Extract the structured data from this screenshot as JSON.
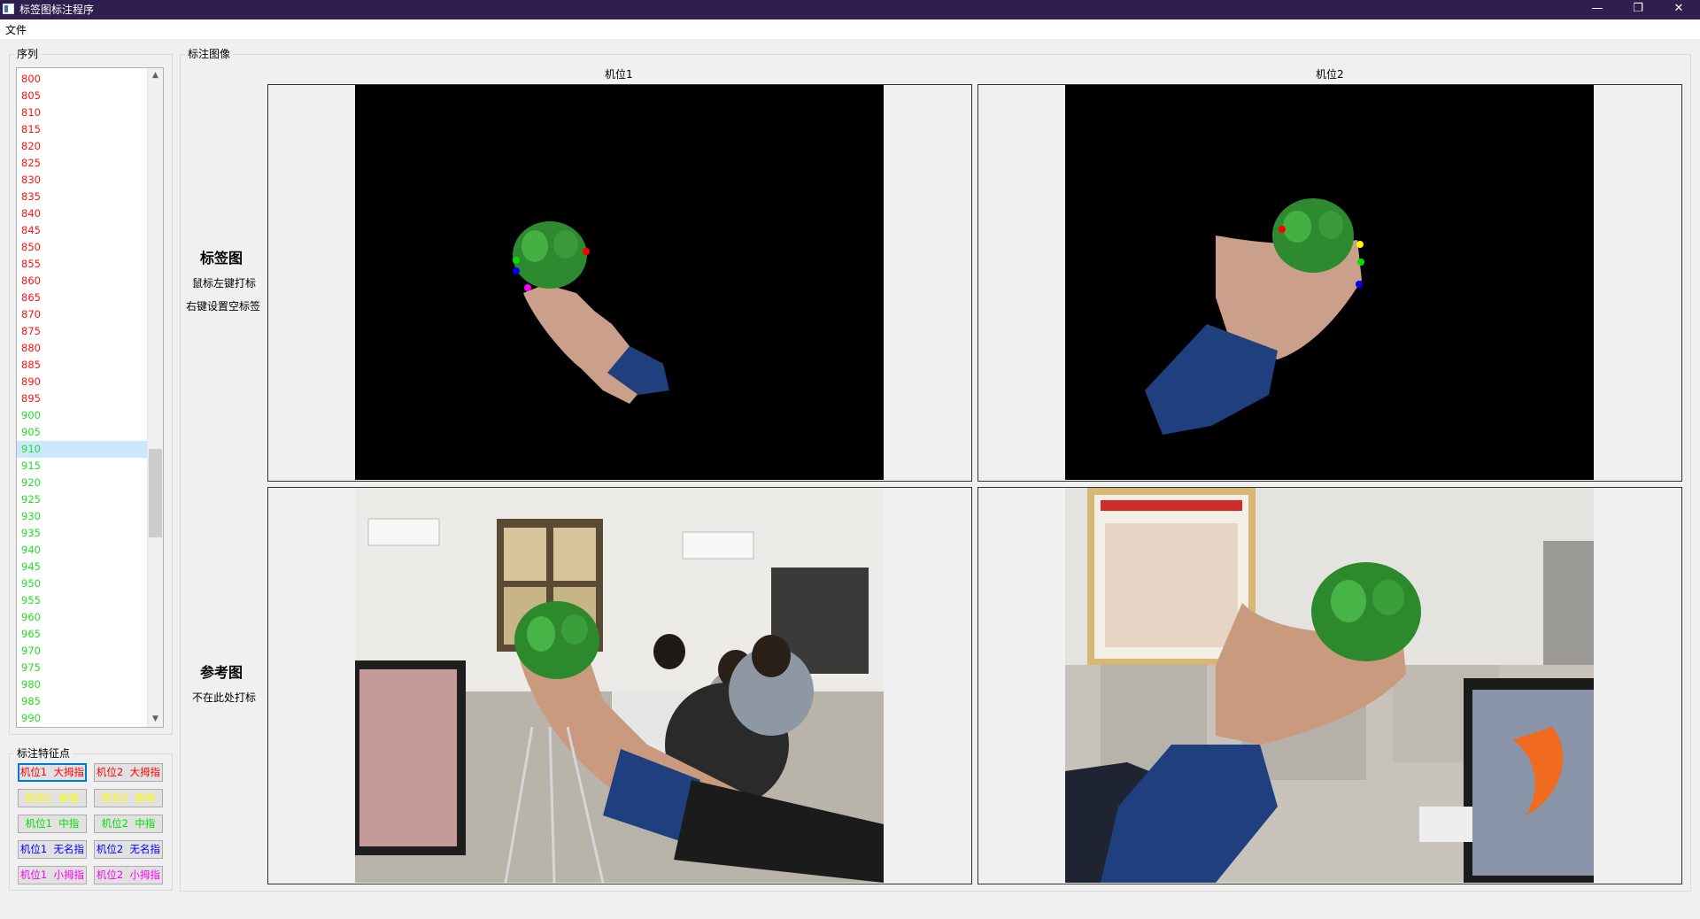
{
  "window": {
    "title": "标签图标注程序",
    "controls": [
      "—",
      "❐",
      "✕"
    ]
  },
  "menu": {
    "file": "文件"
  },
  "sequence": {
    "group_title": "序列",
    "items": [
      {
        "label": "800",
        "state": "labeled"
      },
      {
        "label": "805",
        "state": "labeled"
      },
      {
        "label": "810",
        "state": "labeled"
      },
      {
        "label": "815",
        "state": "labeled"
      },
      {
        "label": "820",
        "state": "labeled"
      },
      {
        "label": "825",
        "state": "labeled"
      },
      {
        "label": "830",
        "state": "labeled"
      },
      {
        "label": "835",
        "state": "labeled"
      },
      {
        "label": "840",
        "state": "labeled"
      },
      {
        "label": "845",
        "state": "labeled"
      },
      {
        "label": "850",
        "state": "labeled"
      },
      {
        "label": "855",
        "state": "labeled"
      },
      {
        "label": "860",
        "state": "labeled"
      },
      {
        "label": "865",
        "state": "labeled"
      },
      {
        "label": "870",
        "state": "labeled"
      },
      {
        "label": "875",
        "state": "labeled"
      },
      {
        "label": "880",
        "state": "labeled"
      },
      {
        "label": "885",
        "state": "labeled"
      },
      {
        "label": "890",
        "state": "labeled"
      },
      {
        "label": "895",
        "state": "labeled"
      },
      {
        "label": "900",
        "state": "pending"
      },
      {
        "label": "905",
        "state": "pending"
      },
      {
        "label": "910",
        "state": "pending",
        "selected": true
      },
      {
        "label": "915",
        "state": "pending"
      },
      {
        "label": "920",
        "state": "pending"
      },
      {
        "label": "925",
        "state": "pending"
      },
      {
        "label": "930",
        "state": "pending"
      },
      {
        "label": "935",
        "state": "pending"
      },
      {
        "label": "940",
        "state": "pending"
      },
      {
        "label": "945",
        "state": "pending"
      },
      {
        "label": "950",
        "state": "pending"
      },
      {
        "label": "955",
        "state": "pending"
      },
      {
        "label": "960",
        "state": "pending"
      },
      {
        "label": "965",
        "state": "pending"
      },
      {
        "label": "970",
        "state": "pending"
      },
      {
        "label": "975",
        "state": "pending"
      },
      {
        "label": "980",
        "state": "pending"
      },
      {
        "label": "985",
        "state": "pending"
      },
      {
        "label": "990",
        "state": "pending"
      }
    ]
  },
  "features": {
    "group_title": "标注特征点",
    "rows": [
      {
        "cam1": "机位1  大拇指",
        "cam2": "机位2  大拇指",
        "color": "#ff0000",
        "active_cam1": true
      },
      {
        "cam1": "机位1  食指",
        "cam2": "机位2  食指",
        "color": "#ffff00"
      },
      {
        "cam1": "机位1  中指",
        "cam2": "机位2  中指",
        "color": "#00e000"
      },
      {
        "cam1": "机位1  无名指",
        "cam2": "机位2  无名指",
        "color": "#0000ff"
      },
      {
        "cam1": "机位1  小拇指",
        "cam2": "机位2  小拇指",
        "color": "#ff00ff"
      }
    ]
  },
  "annotation": {
    "group_title": "标注图像",
    "cam1_label": "机位1",
    "cam2_label": "机位2",
    "label_row": {
      "title": "标签图",
      "hint1": "鼠标左键打标",
      "hint2": "右键设置空标签"
    },
    "ref_row": {
      "title": "参考图",
      "hint1": "不在此处打标"
    }
  },
  "colors": {
    "labeled": "#ff1010",
    "pending": "#1fe01f",
    "selected_bg": "#cce8ff",
    "titlebar": "#2e1f4f"
  }
}
